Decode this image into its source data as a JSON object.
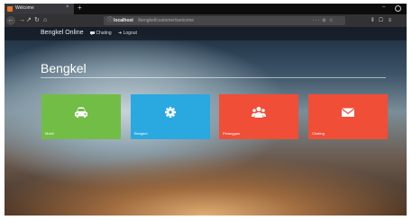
{
  "browser": {
    "tab_title": "Welcome",
    "tab_close": "×",
    "new_tab": "+",
    "url_host": "localhost",
    "url_path": "/bengkel/customer/welcome",
    "url_right_icons": "··· ⊙ ☆",
    "nav_right_icons": "⫴ ▢ ≡",
    "minimize": "–"
  },
  "site": {
    "brand": "Bengkel Online",
    "menu": [
      {
        "label": "Chating"
      },
      {
        "label": "Logout"
      }
    ],
    "page_title": "Bengkel"
  },
  "tiles": [
    {
      "label": "Mobil",
      "color": "#72bd45",
      "icon": "car-icon"
    },
    {
      "label": "Bengkel",
      "color": "#2aa8e0",
      "icon": "gear-icon"
    },
    {
      "label": "Pelanggan",
      "color": "#f04e37",
      "icon": "users-icon"
    },
    {
      "label": "Chating",
      "color": "#f04e37",
      "icon": "envelope-icon"
    }
  ]
}
